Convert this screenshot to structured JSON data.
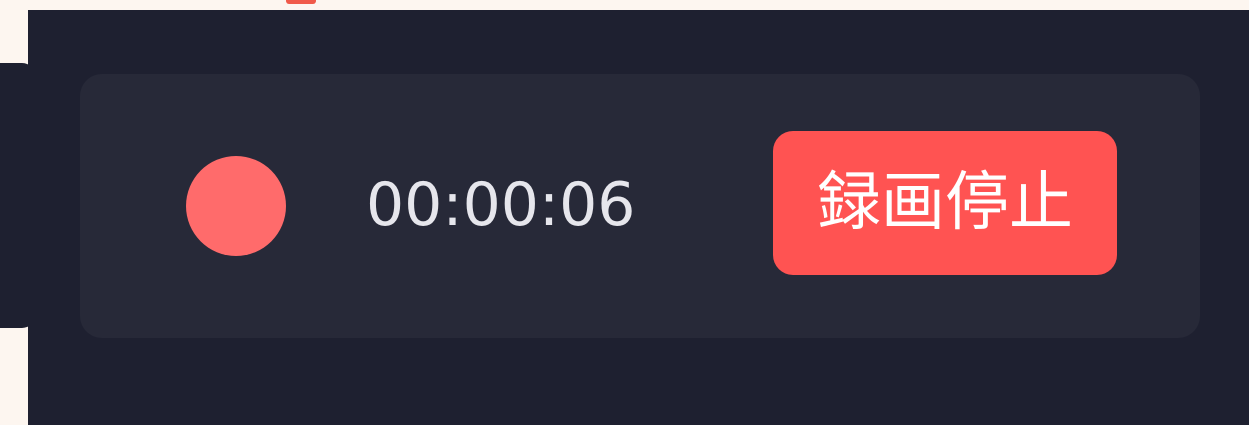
{
  "recorder": {
    "elapsed_time": "00:00:06",
    "stop_label": "録画停止",
    "status": "recording"
  },
  "colors": {
    "page_background": "#fdf6f0",
    "panel_background": "#1e2030",
    "bar_background": "#272938",
    "record_dot": "#ff6b6b",
    "stop_button": "#ff5352",
    "timer_text": "#e6e6ec",
    "accent": "#f05a4a"
  },
  "icons": {
    "record_indicator": "record-dot-icon"
  }
}
